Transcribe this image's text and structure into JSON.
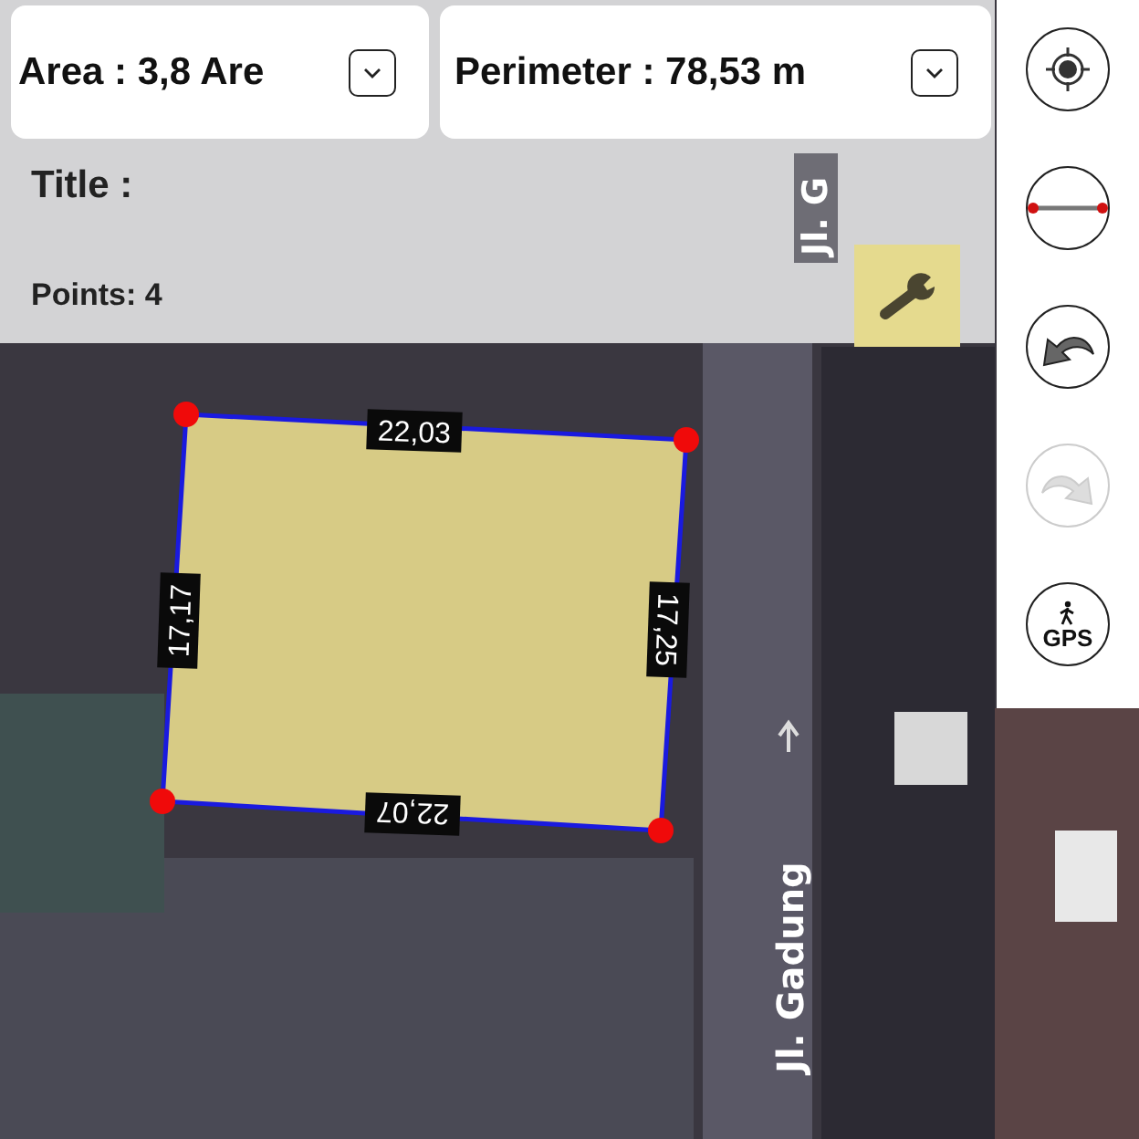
{
  "summary": [
    {
      "label": "Area : 3,8 Are"
    },
    {
      "label": "Perimeter : 78,53 m"
    }
  ],
  "title_label": "Title :",
  "points_label": "Points: 4",
  "tools": [
    {
      "kind": "locate",
      "disabled": false
    },
    {
      "kind": "measure",
      "disabled": false
    },
    {
      "kind": "undo",
      "disabled": false
    },
    {
      "kind": "redo",
      "disabled": true
    },
    {
      "kind": "gps",
      "label": "GPS",
      "disabled": false
    }
  ],
  "polygon": {
    "edges": [
      "22,03",
      "17,25",
      "22,07",
      "17,17"
    ]
  },
  "street_labels": [
    "Jl. Gadung",
    "Jl. G"
  ]
}
